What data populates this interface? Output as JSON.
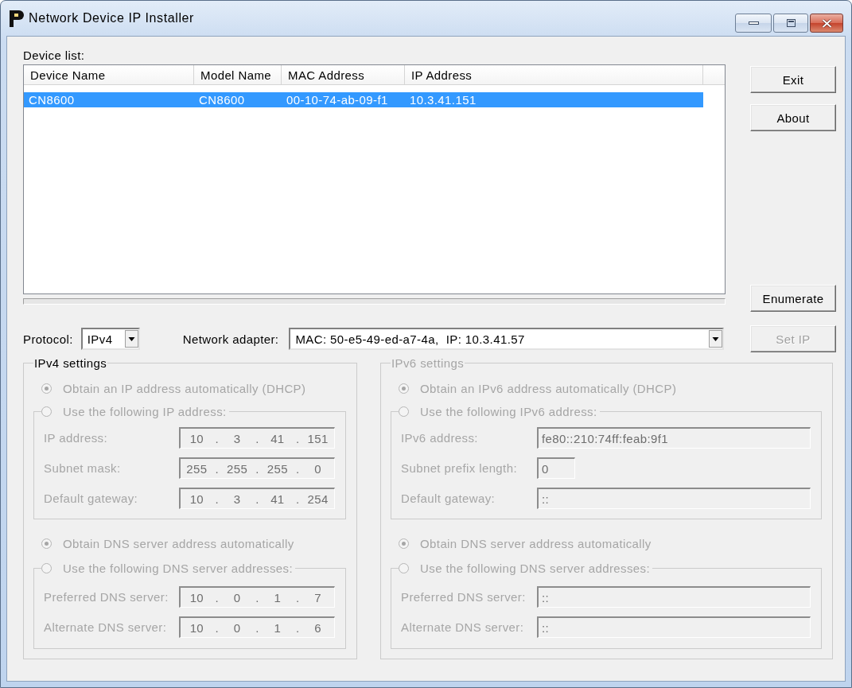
{
  "window": {
    "title": "Network Device IP Installer"
  },
  "device_list": {
    "label": "Device list:",
    "columns": [
      "Device Name",
      "Model Name",
      "MAC Address",
      "IP Address"
    ],
    "rows": [
      {
        "cells": [
          "CN8600",
          "CN8600",
          "00-10-74-ab-09-f1",
          "10.3.41.151"
        ],
        "selected": true
      }
    ]
  },
  "exit_button": {
    "label": "Exit",
    "disabled": false
  },
  "about_button": {
    "label": "About",
    "disabled": false
  },
  "enumerate_button": {
    "label": "Enumerate",
    "disabled": false
  },
  "protocol": {
    "label": "Protocol:",
    "value": "IPv4"
  },
  "network_adapter": {
    "label": "Network adapter:",
    "value": "MAC: 50-e5-49-ed-a7-4a,  IP: 10.3.41.57"
  },
  "set_ip_button": {
    "label": "Set IP",
    "disabled": true
  },
  "ipv4_settings": {
    "title": "IPv4 settings",
    "disabled": false,
    "auto_address": {
      "label": "Obtain an IP address automatically (DHCP)",
      "selected": true,
      "disabled": true
    },
    "manual_address": {
      "label": "Use the following IP address:",
      "selected": false,
      "disabled": true,
      "fields": [
        {
          "kind": "ip",
          "label": "IP address:",
          "segments": [
            "10",
            ".",
            "3",
            ".",
            "41",
            ".",
            "151"
          ],
          "disabled": true
        },
        {
          "kind": "ip",
          "label": "Subnet mask:",
          "segments": [
            "255",
            ".",
            "255",
            ".",
            "255",
            ".",
            "0"
          ],
          "disabled": true
        },
        {
          "kind": "ip",
          "label": "Default gateway:",
          "segments": [
            "10",
            ".",
            "3",
            ".",
            "41",
            ".",
            "254"
          ],
          "disabled": true
        }
      ]
    },
    "auto_dns": {
      "label": "Obtain DNS server address automatically",
      "selected": true,
      "disabled": true
    },
    "manual_dns": {
      "label": "Use the following DNS server addresses:",
      "selected": false,
      "disabled": true,
      "fields": [
        {
          "kind": "ip",
          "label": "Preferred DNS server:",
          "segments": [
            "10",
            ".",
            "0",
            ".",
            "1",
            ".",
            "7"
          ],
          "disabled": true
        },
        {
          "kind": "ip",
          "label": "Alternate DNS server:",
          "segments": [
            "10",
            ".",
            "0",
            ".",
            "1",
            ".",
            "6"
          ],
          "disabled": true
        }
      ]
    }
  },
  "ipv6_settings": {
    "title": "IPv6 settings",
    "disabled": true,
    "auto_address": {
      "label": "Obtain an IPv6 address automatically (DHCP)",
      "selected": true,
      "disabled": true
    },
    "manual_address": {
      "label": "Use the following IPv6 address:",
      "selected": false,
      "disabled": true,
      "fields": [
        {
          "kind": "text",
          "label": "IPv6 address:",
          "value": "fe80::210:74ff:feab:9f1",
          "disabled": true
        },
        {
          "kind": "short",
          "label": "Subnet prefix length:",
          "value": "0",
          "disabled": true
        },
        {
          "kind": "text",
          "label": "Default gateway:",
          "value": "::",
          "disabled": true
        }
      ]
    },
    "auto_dns": {
      "label": "Obtain DNS server address automatically",
      "selected": true,
      "disabled": true
    },
    "manual_dns": {
      "label": "Use the following DNS server addresses:",
      "selected": false,
      "disabled": true,
      "fields": [
        {
          "kind": "text",
          "label": "Preferred DNS server:",
          "value": "::",
          "disabled": true
        },
        {
          "kind": "text",
          "label": "Alternate DNS server:",
          "value": "::",
          "disabled": true
        }
      ]
    }
  }
}
